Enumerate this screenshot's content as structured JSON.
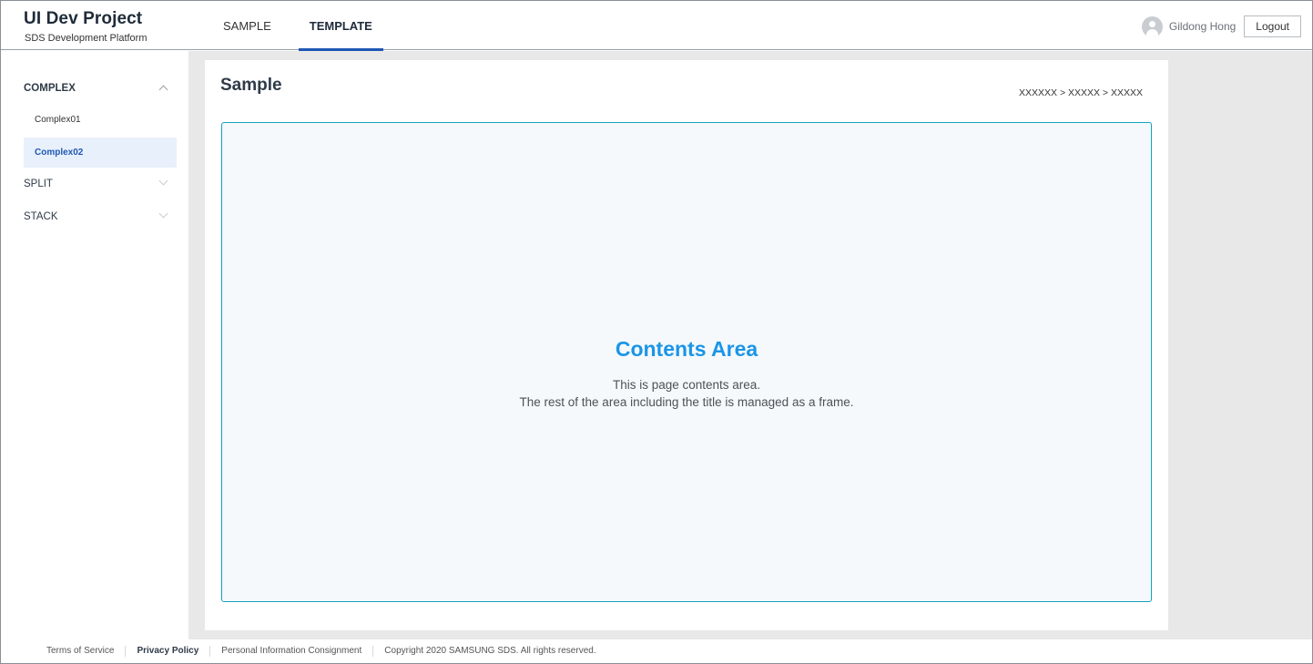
{
  "header": {
    "title": "UI Dev Project",
    "subtitle": "SDS Development Platform",
    "nav": [
      "SAMPLE",
      "TEMPLATE"
    ],
    "active_nav": "TEMPLATE",
    "user_name": "Gildong Hong",
    "logout_label": "Logout"
  },
  "sidebar": {
    "groups": [
      {
        "label": "COMPLEX",
        "expanded": true,
        "items": [
          "Complex01",
          "Complex02"
        ],
        "active_item": "Complex02"
      },
      {
        "label": "SPLIT",
        "expanded": false
      },
      {
        "label": "STACK",
        "expanded": false
      }
    ]
  },
  "main": {
    "page_title": "Sample",
    "breadcrumb": "XXXXXX > XXXXX > XXXXX",
    "contents_title": "Contents Area",
    "contents_line1": "This is page contents area.",
    "contents_line2": "The rest of the area including the title is managed as a frame."
  },
  "footer": {
    "links": [
      "Terms of Service",
      "Privacy Policy",
      "Personal Information Consignment"
    ],
    "copyright": "Copyright 2020 SAMSUNG SDS. All rights reserved."
  },
  "colors": {
    "accent": "#1e57b5",
    "contents_border": "#13a1bd",
    "contents_title": "#1b95e6",
    "active_menu_bg": "#e8f0fb"
  }
}
